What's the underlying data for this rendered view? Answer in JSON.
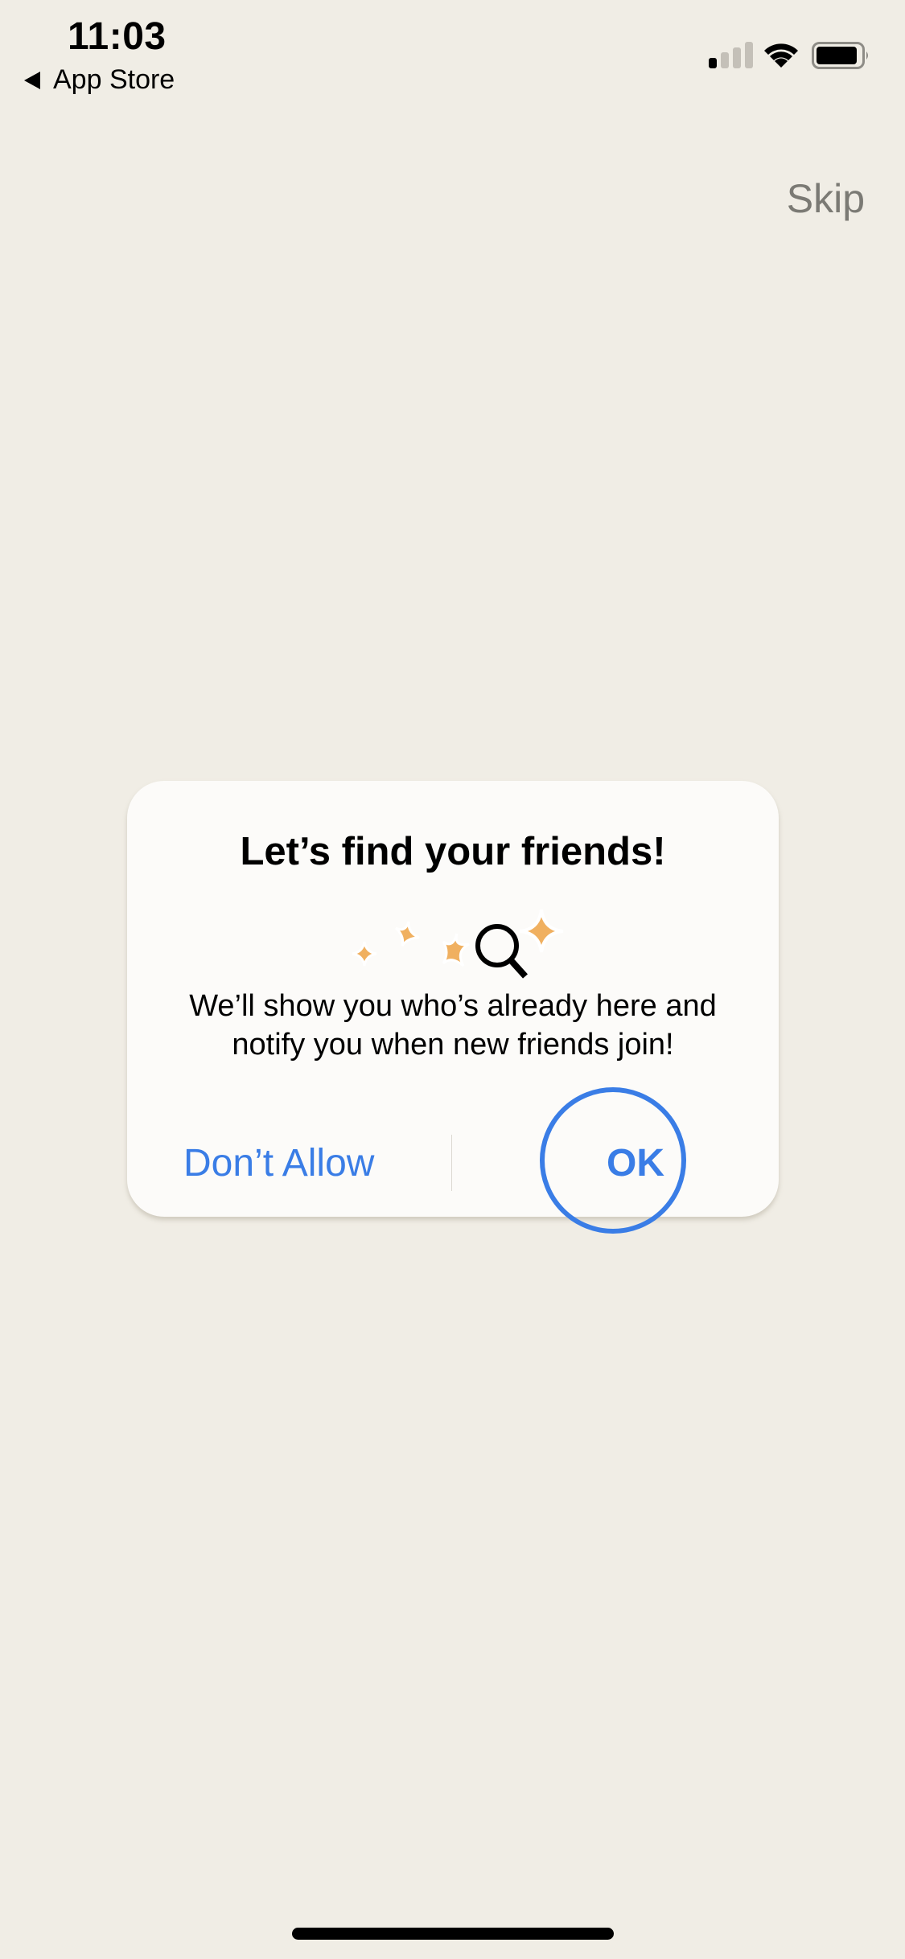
{
  "status_bar": {
    "time": "11:03",
    "back_label": "App Store",
    "signal_bars_active": 1,
    "signal_bars_total": 4,
    "battery_level": 0.8,
    "icons": [
      "back-triangle-icon",
      "cellular-signal-icon",
      "wifi-icon",
      "battery-icon"
    ]
  },
  "header": {
    "skip_label": "Skip"
  },
  "dialog": {
    "title": "Let’s find your friends!",
    "illustration": [
      "sparkle-icon",
      "sparkle-icon",
      "sparkle-icon",
      "magnifier-icon",
      "sparkle-icon"
    ],
    "body": "We’ll show you who’s already here and notify you when new friends join!",
    "deny_label": "Don’t Allow",
    "ok_label": "OK"
  },
  "colors": {
    "background": "#f0ede5",
    "dialog": "#fcfbf9",
    "accent": "#3a7de6",
    "sparkle": "#f0b060",
    "skip_text": "#7b7a74"
  }
}
